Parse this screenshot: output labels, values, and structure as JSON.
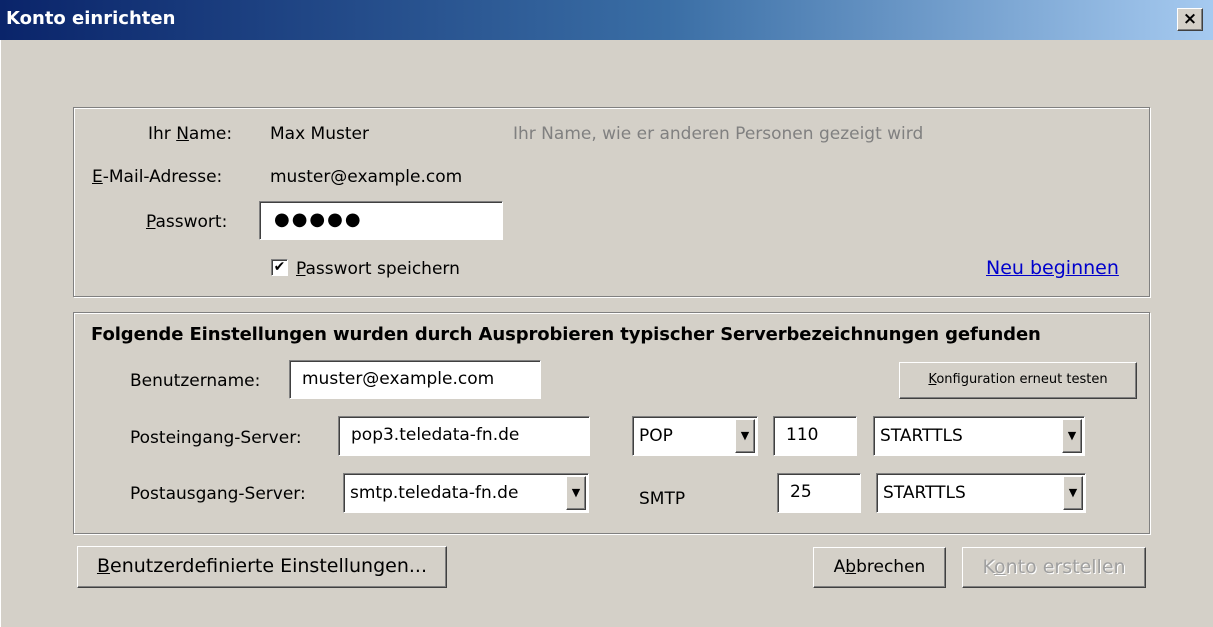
{
  "window": {
    "title": "Konto einrichten",
    "close_glyph": "×"
  },
  "identity": {
    "name_label_pre": "Ihr ",
    "name_label_key": "N",
    "name_label_post": "ame:",
    "name_value": "Max Muster",
    "name_hint": "Ihr Name, wie er anderen Personen gezeigt wird",
    "email_label_key": "E",
    "email_label_post": "-Mail-Adresse:",
    "email_value": "muster@example.com",
    "password_label_key": "P",
    "password_label_post": "asswort:",
    "password_value": "●●●●●",
    "save_password_checked": true,
    "save_password_key": "P",
    "save_password_post": "asswort speichern",
    "restart_link": "Neu beginnen"
  },
  "server_settings": {
    "heading": "Folgende Einstellungen wurden durch Ausprobieren typischer Serverbezeichnungen gefunden",
    "username_label": "Benutzername:",
    "username_value": "muster@example.com",
    "retest_key": "K",
    "retest_post": "onfiguration erneut testen",
    "incoming_label": "Posteingang-Server:",
    "incoming_host": "pop3.teledata-fn.de",
    "incoming_protocol": "POP",
    "incoming_port": "110",
    "incoming_security": "STARTTLS",
    "outgoing_label": "Postausgang-Server:",
    "outgoing_host": "smtp.teledata-fn.de",
    "outgoing_protocol": "SMTP",
    "outgoing_port": "25",
    "outgoing_security": "STARTTLS"
  },
  "buttons": {
    "custom_key": "B",
    "custom_post": "enutzerdefinierte Einstellungen...",
    "cancel_pre": "A",
    "cancel_key": "b",
    "cancel_post": "brechen",
    "create_pre": "K",
    "create_key": "o",
    "create_post": "nto erstellen"
  },
  "icons": {
    "close": "close-icon",
    "checkbox": "checkmark-icon",
    "dropdown": "chevron-down-icon"
  }
}
